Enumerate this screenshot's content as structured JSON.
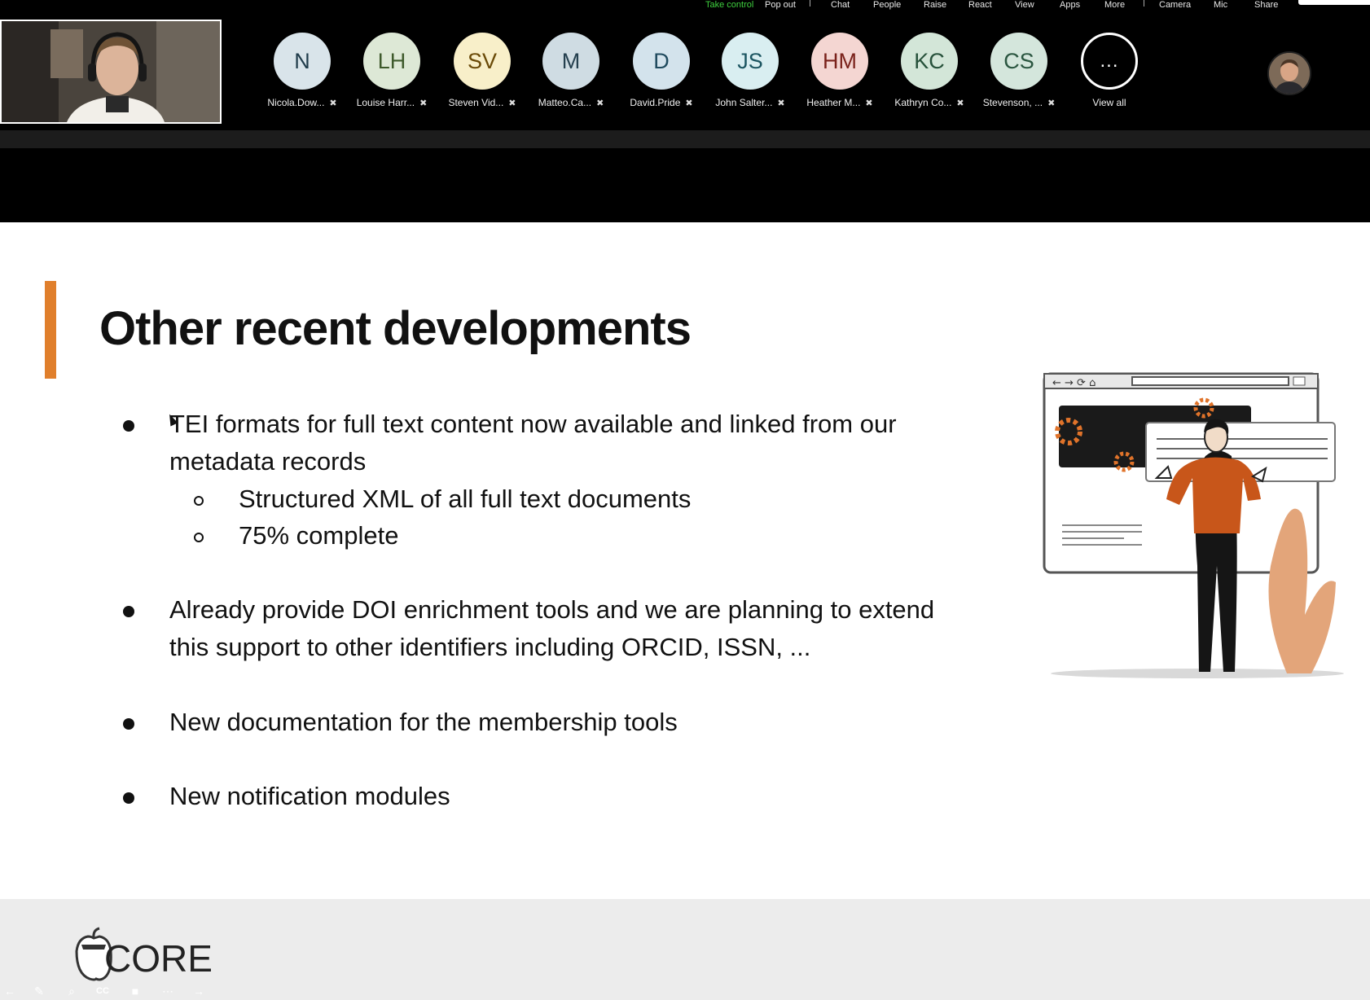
{
  "meeting": {
    "toolbar": [
      {
        "id": "take-control",
        "label": "Take control",
        "color": "#3fd13f"
      },
      {
        "id": "pop-out",
        "label": "Pop out"
      },
      {
        "id": "chat",
        "label": "Chat"
      },
      {
        "id": "people",
        "label": "People"
      },
      {
        "id": "raise",
        "label": "Raise"
      },
      {
        "id": "react",
        "label": "React"
      },
      {
        "id": "view",
        "label": "View"
      },
      {
        "id": "apps",
        "label": "Apps"
      },
      {
        "id": "more",
        "label": "More"
      },
      {
        "id": "camera",
        "label": "Camera"
      },
      {
        "id": "mic",
        "label": "Mic"
      },
      {
        "id": "share",
        "label": "Share"
      }
    ],
    "participants": [
      {
        "initials": "N",
        "name": "Nicola.Dow...",
        "bg": "#d9e4ea",
        "fg": "#1f3b4a"
      },
      {
        "initials": "LH",
        "name": "Louise Harr...",
        "bg": "#dde8d6",
        "fg": "#3e5a2c"
      },
      {
        "initials": "SV",
        "name": "Steven Vid...",
        "bg": "#f8efc9",
        "fg": "#6a4a08"
      },
      {
        "initials": "M",
        "name": "Matteo.Ca...",
        "bg": "#cfdce3",
        "fg": "#25404f"
      },
      {
        "initials": "D",
        "name": "David.Pride",
        "bg": "#d3e3ec",
        "fg": "#1f4a5e"
      },
      {
        "initials": "JS",
        "name": "John Salter...",
        "bg": "#d9eef1",
        "fg": "#1c5561"
      },
      {
        "initials": "HM",
        "name": "Heather M...",
        "bg": "#f4d6d2",
        "fg": "#7a221b"
      },
      {
        "initials": "KC",
        "name": "Kathryn Co...",
        "bg": "#d3e6d8",
        "fg": "#26513a"
      },
      {
        "initials": "CS",
        "name": "Stevenson, ...",
        "bg": "#d4e6dc",
        "fg": "#2a5640"
      }
    ],
    "view_all": {
      "icon": "...",
      "label": "View all"
    }
  },
  "slide": {
    "title": "Other recent developments",
    "accent_color": "#e07f2c",
    "bullets": [
      {
        "text_line1": "TEI formats for full text content now available and linked from our",
        "text_line2": "metadata records",
        "sub": [
          "Structured XML of all full text documents",
          "75% complete"
        ]
      },
      {
        "text_line1": "Already provide DOI enrichment tools and we are planning to extend",
        "text_line2": "this support to other identifiers including ORCID, ISSN, ..."
      },
      {
        "text_line1": "New documentation for the membership tools"
      },
      {
        "text_line1": "New notification modules"
      }
    ],
    "logo_text": "CORE"
  }
}
